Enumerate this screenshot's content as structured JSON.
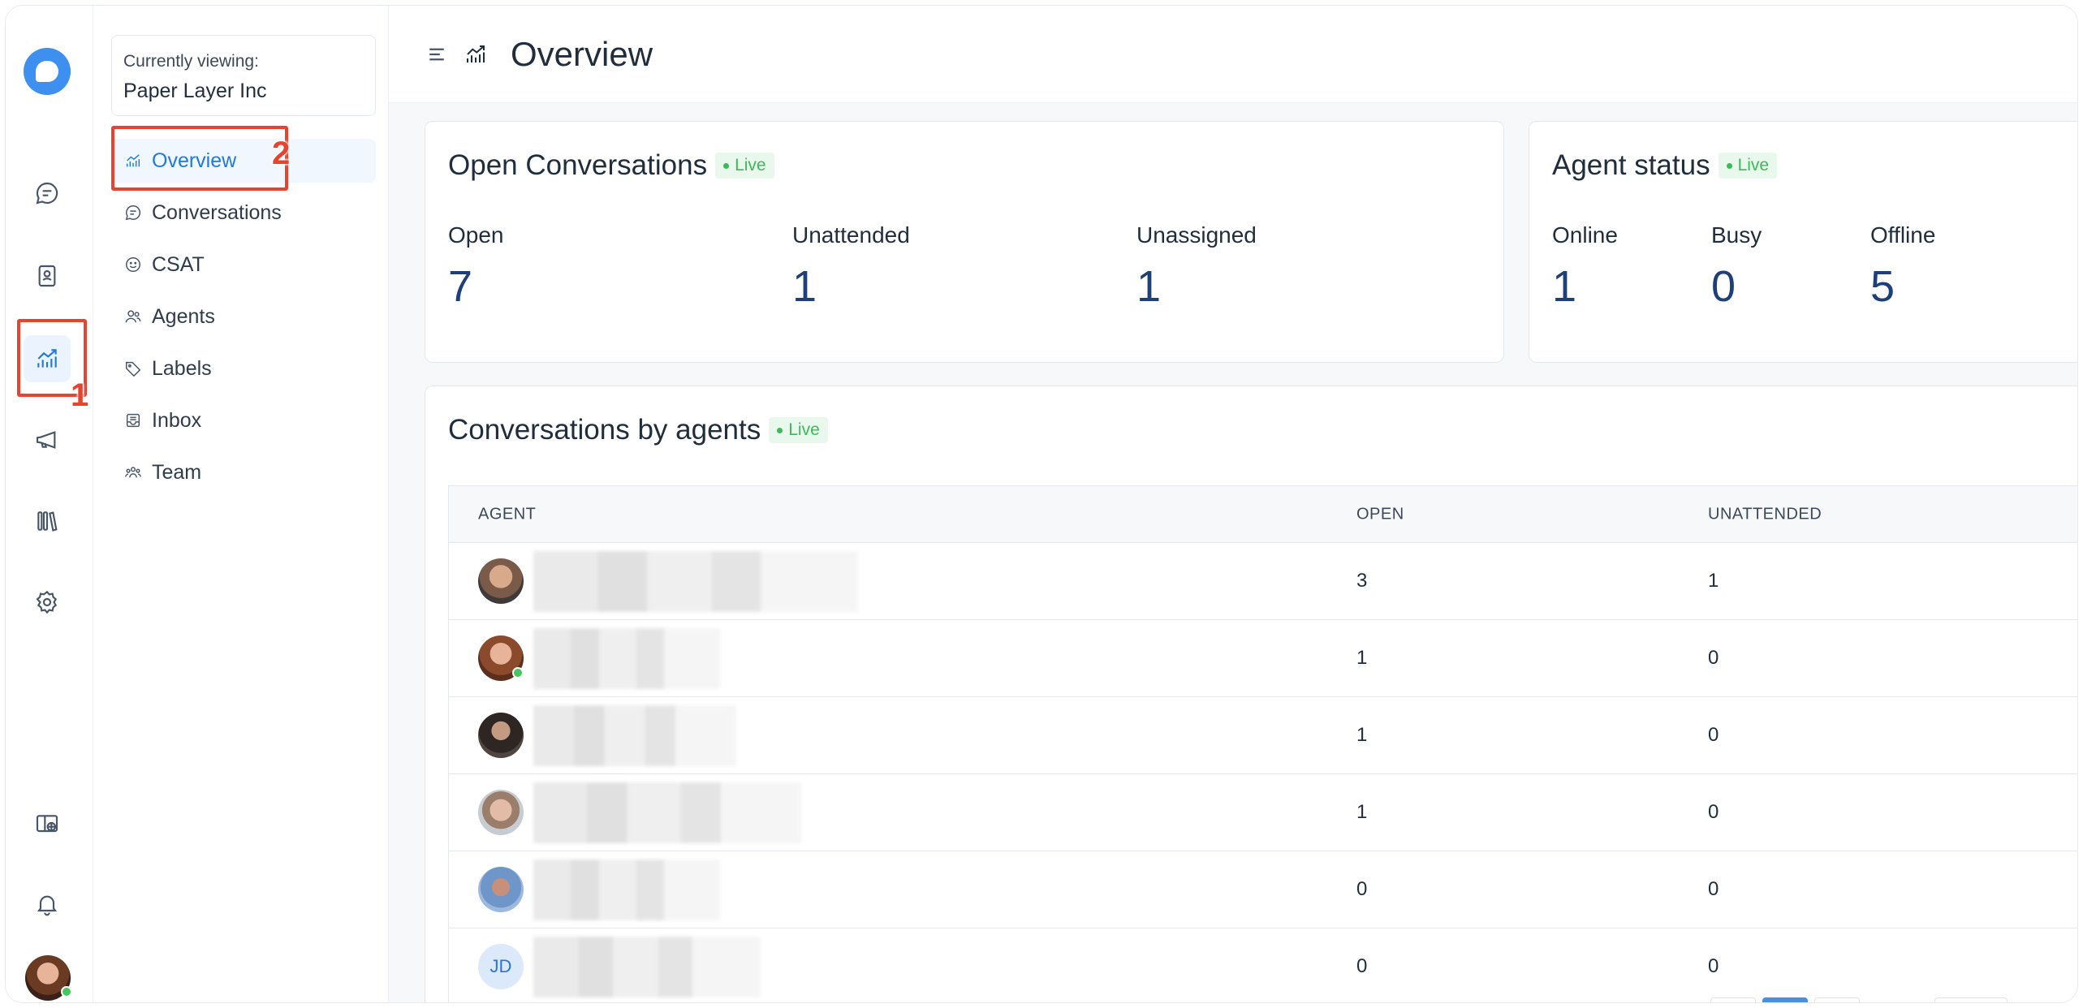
{
  "app": {
    "page_title": "Overview",
    "accent": "#1f7ae0",
    "highlight_color": "#e8432f"
  },
  "rail": {
    "items": [
      {
        "name": "conversations-icon"
      },
      {
        "name": "contacts-icon"
      },
      {
        "name": "reports-icon",
        "active": true
      },
      {
        "name": "campaigns-icon"
      },
      {
        "name": "library-icon"
      },
      {
        "name": "settings-icon"
      }
    ],
    "bottom": [
      {
        "name": "portal-icon"
      },
      {
        "name": "notifications-icon"
      }
    ]
  },
  "annotations": {
    "marker_1": "1",
    "marker_2": "2"
  },
  "sidebar": {
    "viewing_label": "Currently viewing:",
    "viewing_value": "Paper Layer Inc",
    "items": [
      {
        "label": "Overview",
        "icon": "chart-icon",
        "active": true
      },
      {
        "label": "Conversations",
        "icon": "chat-icon"
      },
      {
        "label": "CSAT",
        "icon": "smile-icon"
      },
      {
        "label": "Agents",
        "icon": "users-icon"
      },
      {
        "label": "Labels",
        "icon": "tag-icon"
      },
      {
        "label": "Inbox",
        "icon": "inbox-icon"
      },
      {
        "label": "Team",
        "icon": "team-icon"
      }
    ]
  },
  "open_conversations": {
    "title": "Open Conversations",
    "live": "Live",
    "metrics": [
      {
        "label": "Open",
        "value": "7"
      },
      {
        "label": "Unattended",
        "value": "1"
      },
      {
        "label": "Unassigned",
        "value": "1"
      }
    ]
  },
  "agent_status": {
    "title": "Agent status",
    "live": "Live",
    "metrics": [
      {
        "label": "Online",
        "value": "1"
      },
      {
        "label": "Busy",
        "value": "0"
      },
      {
        "label": "Offline",
        "value": "5"
      }
    ]
  },
  "agents_table": {
    "title": "Conversations by agents",
    "live": "Live",
    "columns": [
      "AGENT",
      "OPEN",
      "UNATTENDED"
    ],
    "rows": [
      {
        "open": "3",
        "unattended": "1"
      },
      {
        "open": "1",
        "unattended": "0",
        "online": true
      },
      {
        "open": "1",
        "unattended": "0"
      },
      {
        "open": "1",
        "unattended": "0"
      },
      {
        "open": "0",
        "unattended": "0"
      },
      {
        "initials": "JD",
        "open": "0",
        "unattended": "0"
      }
    ]
  }
}
